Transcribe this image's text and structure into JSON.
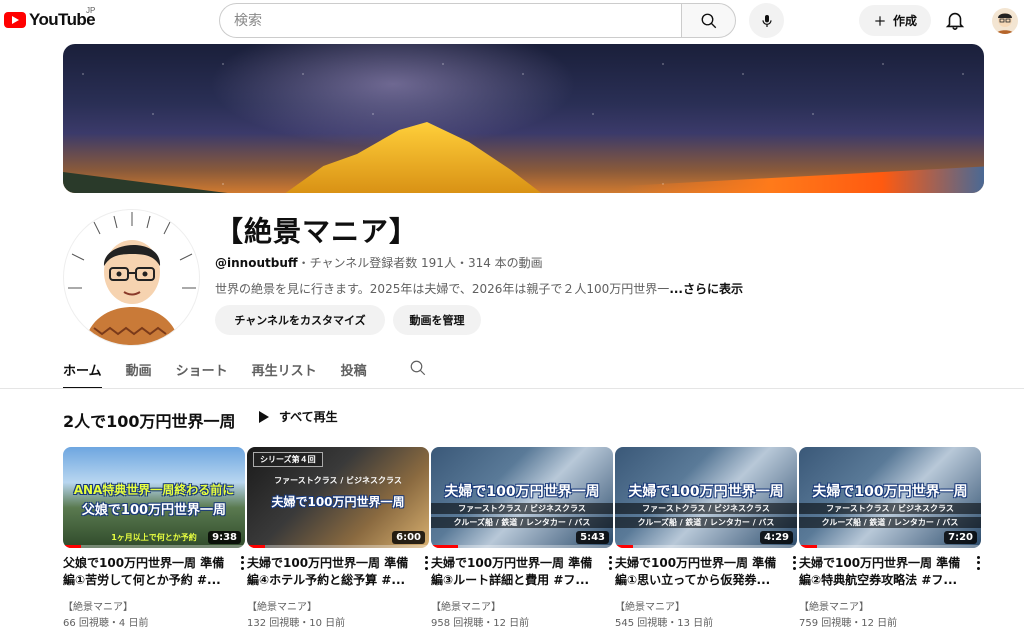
{
  "header": {
    "logo_text": "YouTube",
    "region": "JP",
    "search_placeholder": "検索",
    "create_label": "作成"
  },
  "channel": {
    "name": "【絶景マニア】",
    "handle": "@innoutbuff",
    "stats": "・チャンネル登録者数 191人・314 本の動画",
    "description": "世界の絶景を見に行きます。2025年は夫婦で、2026年は親子で２人100万円世界一",
    "more_label": "...さらに表示",
    "customize_label": "チャンネルをカスタマイズ",
    "manage_label": "動画を管理"
  },
  "tabs": [
    {
      "label": "ホーム",
      "active": true
    },
    {
      "label": "動画"
    },
    {
      "label": "ショート"
    },
    {
      "label": "再生リスト"
    },
    {
      "label": "投稿"
    }
  ],
  "shelf": {
    "title": "2人で100万円世界一周",
    "play_all_label": "すべて再生",
    "videos": [
      {
        "thumb_lines": [
          "ANA特典世界一周終わる前に",
          "父娘で100万円世界一周"
        ],
        "thumb_sub": "1ヶ月以上で何とか予約",
        "duration": "9:38",
        "progress": 0.1,
        "title": "父娘で100万円世界一周 準備編①苦労して何とか予約 #...",
        "channel": "【絶景マニア】",
        "meta": "66 回視聴・4 日前"
      },
      {
        "ribbon": "シリーズ第４回",
        "thumb_lines": [
          "夫婦で100万円世界一周"
        ],
        "thumb_sub": "ファーストクラス / ビジネスクラス",
        "duration": "6:00",
        "progress": 0.1,
        "title": "夫婦で100万円世界一周 準備編④ホテル予約と総予算 #...",
        "channel": "【絶景マニア】",
        "meta": "132 回視聴・10 日前"
      },
      {
        "thumb_lines": [
          "夫婦で100万円世界一周"
        ],
        "thumb_sub": "ファーストクラス / ビジネスクラス",
        "thumb_sub2": "クルーズ船 / 鉄道 / レンタカー / バス",
        "duration": "5:43",
        "progress": 0.15,
        "title": "夫婦で100万円世界一周 準備編③ルート詳細と費用 #フ...",
        "channel": "【絶景マニア】",
        "meta": "958 回視聴・12 日前"
      },
      {
        "thumb_lines": [
          "夫婦で100万円世界一周"
        ],
        "thumb_sub": "ファーストクラス / ビジネスクラス",
        "thumb_sub2": "クルーズ船 / 鉄道 / レンタカー / バス",
        "duration": "4:29",
        "progress": 0.1,
        "title": "夫婦で100万円世界一周 準備編①思い立ってから仮発券...",
        "channel": "【絶景マニア】",
        "meta": "545 回視聴・13 日前"
      },
      {
        "thumb_lines": [
          "夫婦で100万円世界一周"
        ],
        "thumb_sub": "ファーストクラス / ビジネスクラス",
        "thumb_sub2": "クルーズ船 / 鉄道 / レンタカー / バス",
        "duration": "7:20",
        "progress": 0.1,
        "title": "夫婦で100万円世界一周 準備編②特典航空券攻略法 #フ...",
        "channel": "【絶景マニア】",
        "meta": "759 回視聴・12 日前"
      }
    ]
  },
  "colors": {
    "brand_red": "#ff0000",
    "text_primary": "#0f0f0f",
    "text_secondary": "#606060",
    "chip_bg": "#f2f2f2"
  }
}
